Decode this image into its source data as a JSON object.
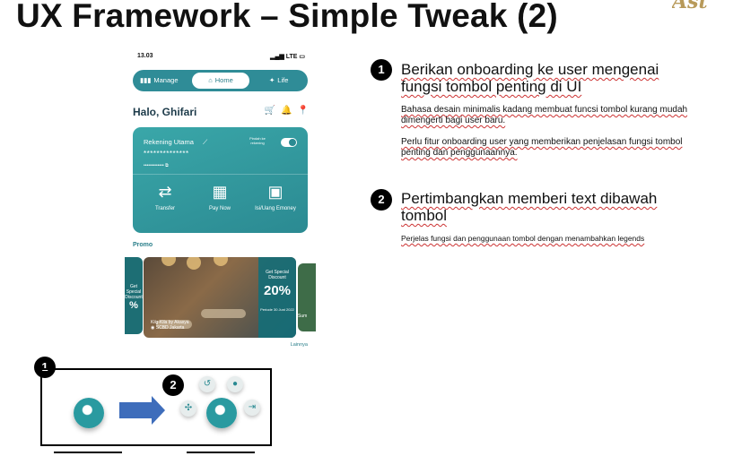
{
  "slide": {
    "title": "UX Framework – Simple Tweak (2)",
    "logo_text": "Ast"
  },
  "phone": {
    "status_time": "13.03",
    "status_net": "LTE",
    "tabs": [
      {
        "label": "Manage"
      },
      {
        "label": "Home"
      },
      {
        "label": "Life"
      }
    ],
    "greeting": "Halo, Ghifari",
    "account_label": "Rekening Utama",
    "account_masked": "**************",
    "account_number": "•••••••••••••",
    "pindah_label": "Pindah ke rekening",
    "actions": [
      {
        "label": "Transfer"
      },
      {
        "label": "Pay Now"
      },
      {
        "label": "Isi/Uang Emoney"
      }
    ],
    "promo_label": "Promo",
    "banner_left_text": "Get Special Discount",
    "banner_left_pct": "%",
    "banner": {
      "place": "Kilg-Kila by Akasya",
      "location": "SCBD Jakarta",
      "discount_small": "Get Special Discount",
      "discount_pct": "20%",
      "period": "Periode 30 Juni 2022"
    },
    "banner_right_text": "Sum",
    "more_link": "Lainnya"
  },
  "points": [
    {
      "number": "1",
      "heading": "Berikan onboarding ke user mengenai fungsi tombol penting di UI",
      "paragraphs": [
        "Bahasa desain minimalis kadang membuat funcsi tombol kurang mudah dimengerti bagi user baru.",
        "Perlu fitur onboarding user yang memberikan penjelasan fungsi tombol penting dan penggunaannya."
      ]
    },
    {
      "number": "2",
      "heading": "Pertimbangkan memberi text dibawah tombol",
      "paragraphs": [
        "Perjelas fungsi dan penggunaan tombol dengan menambahkan legends"
      ]
    }
  ],
  "diagram": {
    "badge1": "1",
    "badge2": "2"
  },
  "colors": {
    "teal": "#2f8c97",
    "arrow_blue": "#3e6dbb",
    "spell_underline": "#cc3333"
  }
}
